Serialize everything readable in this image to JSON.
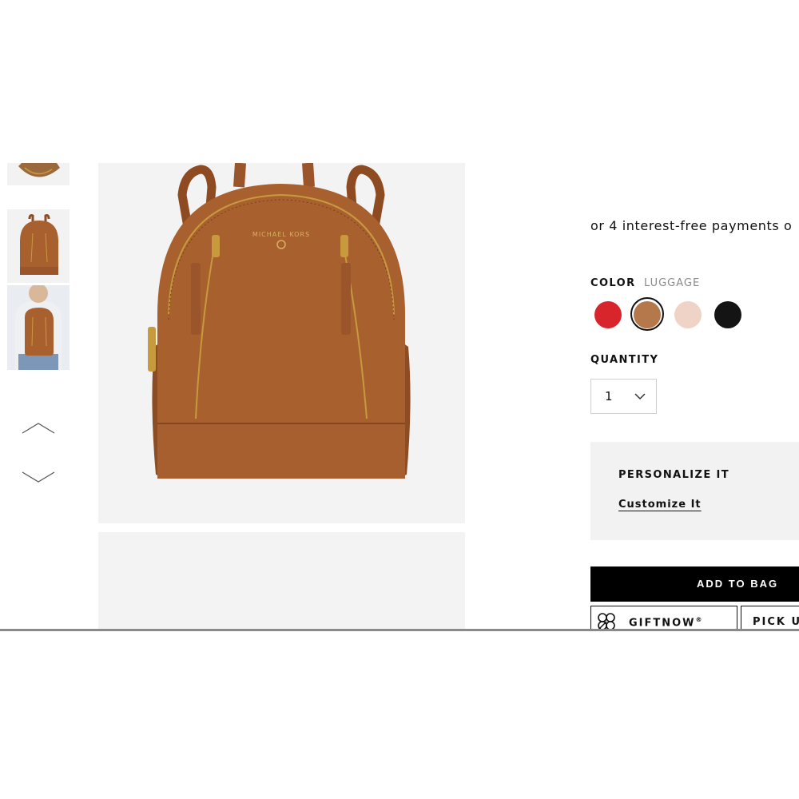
{
  "product": {
    "payments_text": "or 4 interest-free payments o",
    "color": {
      "label": "COLOR",
      "selected": "LUGGAGE",
      "swatches": [
        {
          "name": "red",
          "hex": "#d8252c"
        },
        {
          "name": "luggage",
          "hex": "#b5784a"
        },
        {
          "name": "soft-pink",
          "hex": "#efd3c6"
        },
        {
          "name": "black",
          "hex": "#141414"
        }
      ]
    },
    "quantity": {
      "label": "QUANTITY",
      "value": "1"
    },
    "personalize": {
      "title": "PERSONALIZE IT",
      "link": "Customize It"
    },
    "add_to_bag": "ADD TO BAG",
    "giftnow": {
      "label": "GIFTNOW",
      "mark": "®"
    },
    "pickup": "PICK U"
  },
  "image": {
    "logo_text": "MICHAEL KORS"
  },
  "colors": {
    "leather": "#a9602f",
    "leather_dark": "#7a3f1c",
    "gold": "#c79a3e",
    "panel": "#f3f3f3"
  },
  "icons": [
    "chevron-up-icon",
    "chevron-down-icon",
    "chevron-down-icon",
    "gift-icon"
  ]
}
